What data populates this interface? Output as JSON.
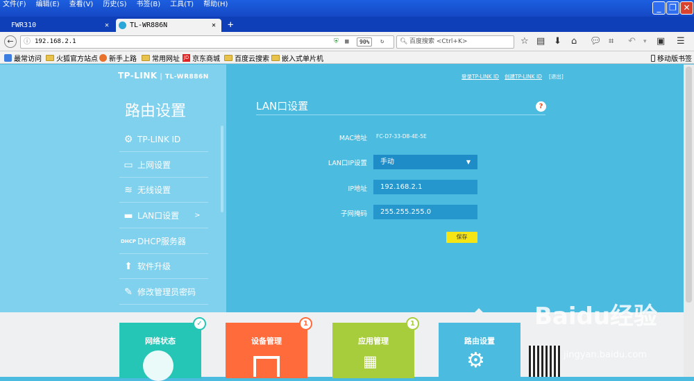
{
  "browser": {
    "menu": [
      "文件(F)",
      "编辑(E)",
      "查看(V)",
      "历史(S)",
      "书签(B)",
      "工具(T)",
      "帮助(H)"
    ],
    "tabs": [
      "FWR310",
      "TL-WR886N"
    ],
    "url": "192.168.2.1",
    "zoom": "90%",
    "search_placeholder": "百度搜索 <Ctrl+K>",
    "bookmarks": [
      "最常访问",
      "火狐官方站点",
      "新手上路",
      "常用网址",
      "京东商城",
      "百度云搜索",
      "嵌入式单片机"
    ],
    "mobile_bookmarks": "移动版书签"
  },
  "header": {
    "brand": "TP-LINK",
    "model": "TL-WR886N",
    "link_login": "登录TP-LINK ID",
    "link_create": "创建TP-LINK ID",
    "link_exit": "[退出]"
  },
  "sidebar": {
    "title": "路由设置",
    "items": [
      {
        "label": "TP-LINK ID",
        "icon": "gear-icon"
      },
      {
        "label": "上网设置",
        "icon": "laptop-icon"
      },
      {
        "label": "无线设置",
        "icon": "wifi-icon"
      },
      {
        "label": "LAN口设置",
        "icon": "router-icon",
        "arrow": ">"
      },
      {
        "label": "DHCP服务器",
        "icon": "dhcp-icon",
        "icon_text": "DHCP"
      },
      {
        "label": "软件升级",
        "icon": "upgrade-icon"
      },
      {
        "label": "修改管理员密码",
        "icon": "pencil-icon"
      }
    ]
  },
  "main": {
    "title": "LAN口设置",
    "help": "?",
    "mac_label": "MAC地址",
    "mac_value": "FC-D7-33-D8-4E-5E",
    "mode_label": "LAN口IP设置",
    "mode_value": "手动",
    "ip_label": "IP地址",
    "ip_value": "192.168.2.1",
    "mask_label": "子网掩码",
    "mask_value": "255.255.255.0",
    "save": "保存"
  },
  "cards": [
    {
      "label": "网络状态",
      "badge": "✓",
      "color": "#25c6b6"
    },
    {
      "label": "设备管理",
      "badge": "1",
      "color": "#ff6b3b"
    },
    {
      "label": "应用管理",
      "badge": "1",
      "color": "#a8cd3c"
    },
    {
      "label": "路由设置",
      "badge": "",
      "color": "#4bbbe0"
    }
  ],
  "watermark": {
    "text": "Baidu经验",
    "url": "jingyan.baidu.com"
  }
}
